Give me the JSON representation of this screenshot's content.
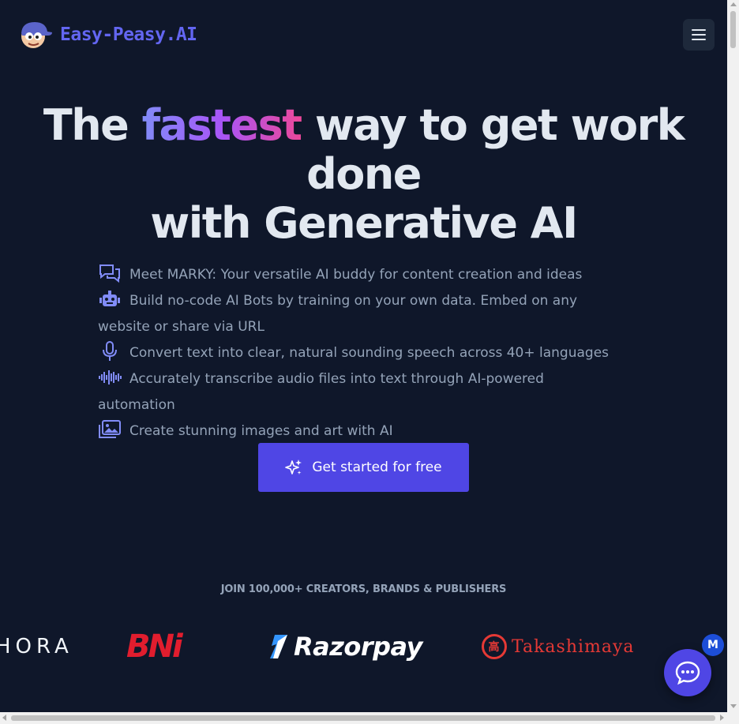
{
  "header": {
    "logo_text": "Easy-Peasy.AI",
    "menu_icon": "hamburger-menu-icon"
  },
  "hero": {
    "title_part1": "The ",
    "title_highlight": "fastest",
    "title_part2": " way to get work done",
    "title_line2": "with Generative AI"
  },
  "features": [
    {
      "icon": "chat-bubbles-icon",
      "text": "Meet MARKY: Your versatile AI buddy for content creation and ideas"
    },
    {
      "icon": "robot-icon",
      "text": "Build no-code AI Bots by training on your own data. Embed on any website or share via URL"
    },
    {
      "icon": "microphone-icon",
      "text": "Convert text into clear, natural sounding speech across 40+ languages"
    },
    {
      "icon": "audio-waveform-icon",
      "text": "Accurately transcribe audio files into text through AI-powered automation"
    },
    {
      "icon": "images-icon",
      "text": "Create stunning images and art with AI"
    }
  ],
  "cta": {
    "label": "Get started for free",
    "icon": "sparkles-icon"
  },
  "social_proof": {
    "heading": "JOIN 100,000+ CREATORS, BRANDS & PUBLISHERS",
    "brands": [
      "HORA",
      "BNi",
      "Razorpay",
      "Takashimaya"
    ],
    "seal_char": "高"
  },
  "widgets": {
    "badge_letter": "M",
    "chat_icon": "chat-icon"
  },
  "colors": {
    "background": "#0f172a",
    "accent": "#4f46e5",
    "logo": "#6366f1",
    "highlight_gradient": [
      "#818cf8",
      "#a855f7",
      "#ec4899"
    ]
  }
}
